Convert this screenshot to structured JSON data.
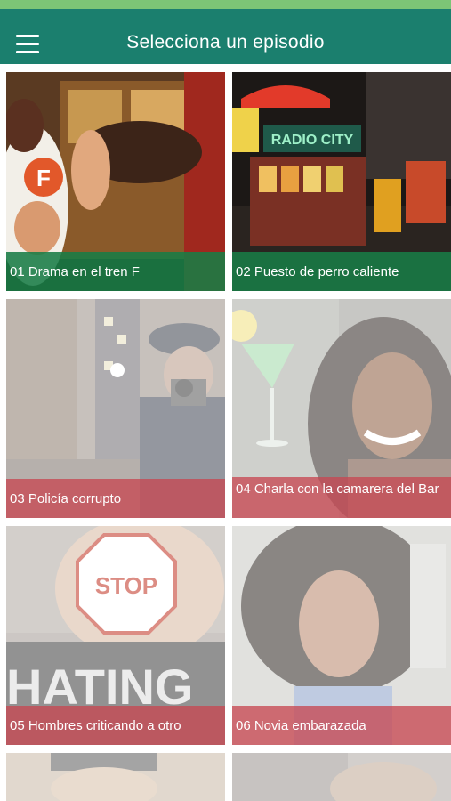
{
  "appbar": {
    "title": "Selecciona un episodio",
    "menu_icon": "hamburger-menu-icon"
  },
  "colors": {
    "accent_bar": "#7cc576",
    "appbar": "#1b7f6e",
    "caption_green": "#187c46",
    "caption_red": "#c64852"
  },
  "episodes": [
    {
      "label": "01 Drama en el tren F",
      "state": "available",
      "caption_color": "green"
    },
    {
      "label": "02 Puesto de perro caliente",
      "state": "available",
      "caption_color": "green"
    },
    {
      "label": "03 Policía corrupto",
      "state": "locked",
      "caption_color": "red"
    },
    {
      "label": "04 Charla con la camarera del Bar",
      "state": "locked",
      "caption_color": "red"
    },
    {
      "label": "05 Hombres criticando a otro",
      "state": "locked",
      "caption_color": "red"
    },
    {
      "label": "06 Novia embarazada",
      "state": "locked",
      "caption_color": "red"
    }
  ],
  "thumb_text": {
    "ep1_sign": "F",
    "ep2_sign": "RADIO CITY",
    "ep5_sign": "STOP",
    "ep5_word": "HATING"
  }
}
